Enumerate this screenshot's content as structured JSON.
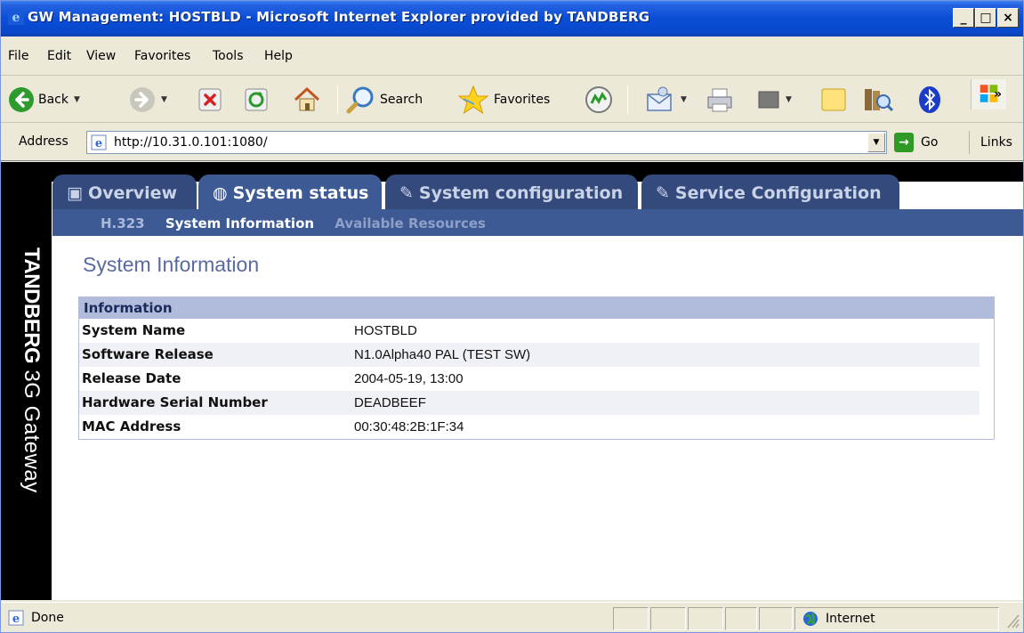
{
  "window": {
    "title": "GW Management: HOSTBLD - Microsoft Internet Explorer provided by TANDBERG",
    "min_label": "_",
    "max_label": "□",
    "close_label": "×"
  },
  "menu": {
    "items": [
      "File",
      "Edit",
      "View",
      "Favorites",
      "Tools",
      "Help"
    ]
  },
  "toolbar": {
    "back_label": "Back",
    "search_label": "Search",
    "favorites_label": "Favorites",
    "more_label": "»"
  },
  "address": {
    "label": "Address",
    "url": "http://10.31.0.101:1080/",
    "go_label": "Go",
    "links_label": "Links"
  },
  "brand": {
    "name_bold": "TANDBERG",
    "name_rest": " 3G Gateway"
  },
  "tabs": [
    {
      "label": "Overview",
      "icon": "▣",
      "active": false
    },
    {
      "label": "System status",
      "icon": "◍",
      "active": true
    },
    {
      "label": "System configuration",
      "icon": "✎",
      "active": false
    },
    {
      "label": "Service Configuration",
      "icon": "✎",
      "active": false
    }
  ],
  "subnav": {
    "h323": "H.323",
    "system_information": "System Information",
    "available_resources": "Available Resources"
  },
  "page_title": "System Information",
  "info": {
    "header": "Information",
    "rows": [
      {
        "key": "System Name",
        "value": "HOSTBLD"
      },
      {
        "key": "Software Release",
        "value": "N1.0Alpha40 PAL (TEST SW)"
      },
      {
        "key": "Release Date",
        "value": "2004-05-19, 13:00"
      },
      {
        "key": "Hardware Serial Number",
        "value": "DEADBEEF"
      },
      {
        "key": "MAC Address",
        "value": "00:30:48:2B:1F:34"
      }
    ]
  },
  "status": {
    "text": "Done",
    "zone": "Internet"
  },
  "colors": {
    "title_bar": "#0a4dd6",
    "tab_active": "#3e5a95",
    "tab_inactive": "#344a7c",
    "info_header": "#b1bbdb",
    "page_title": "#5a6aa0"
  }
}
